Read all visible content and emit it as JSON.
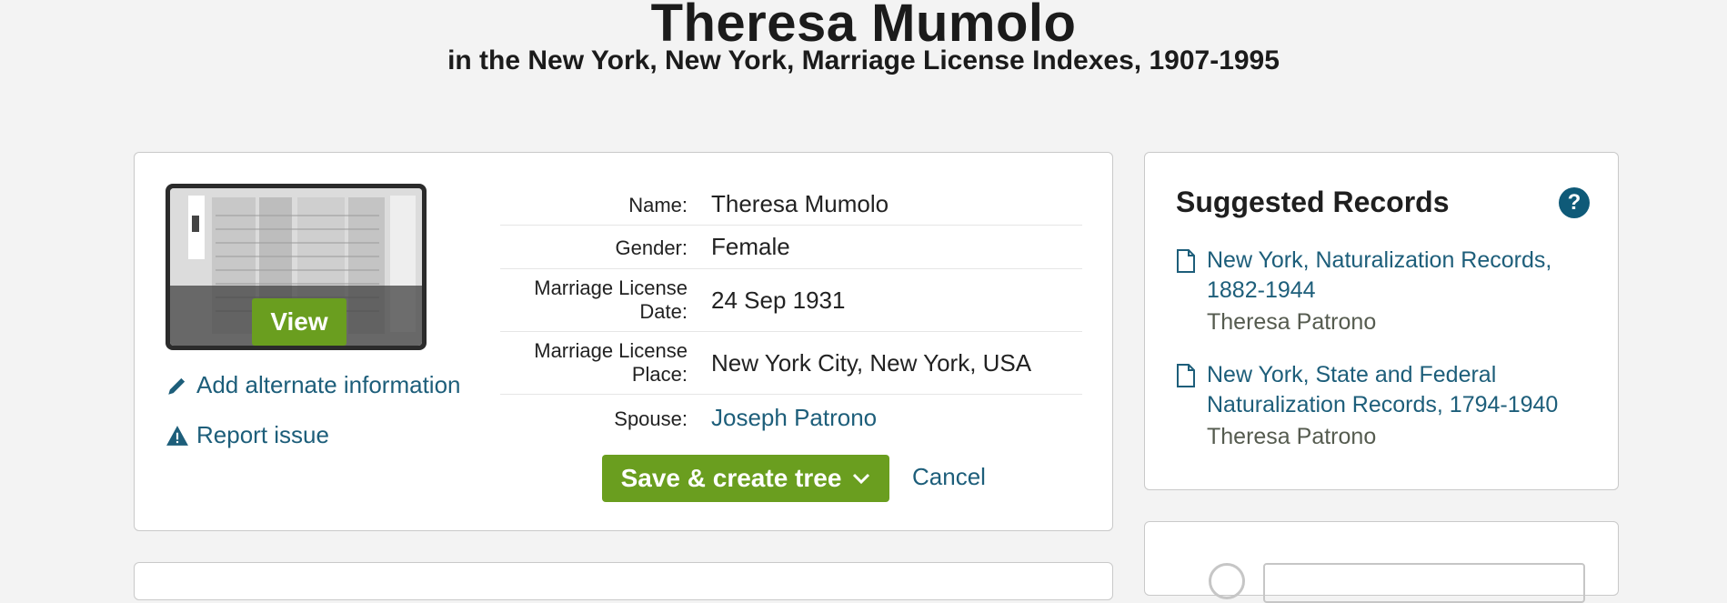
{
  "page": {
    "title": "Theresa Mumolo",
    "subtitle": "in the New York, New York, Marriage License Indexes, 1907-1995"
  },
  "record": {
    "view_label": "View",
    "add_alternate_label": "Add alternate information",
    "report_issue_label": "Report issue",
    "facts": [
      {
        "label": "Name:",
        "value": "Theresa Mumolo"
      },
      {
        "label": "Gender:",
        "value": "Female"
      },
      {
        "label": "Marriage License Date:",
        "value": "24 Sep 1931"
      },
      {
        "label": "Marriage License Place:",
        "value": "New York City, New York, USA"
      },
      {
        "label": "Spouse:",
        "value": "Joseph Patrono"
      }
    ],
    "save_label": "Save & create tree",
    "cancel_label": "Cancel"
  },
  "suggested": {
    "title": "Suggested Records",
    "help_label": "?",
    "records": [
      {
        "title": "New York, Naturalization Records, 1882-1944",
        "person": "Theresa Patrono"
      },
      {
        "title": "New York, State and Federal Naturalization Records, 1794-1940",
        "person": "Theresa Patrono"
      }
    ]
  },
  "colors": {
    "accent_green": "#6a9e1f",
    "link_blue": "#1d5e7a",
    "background": "#f3f3f3"
  }
}
